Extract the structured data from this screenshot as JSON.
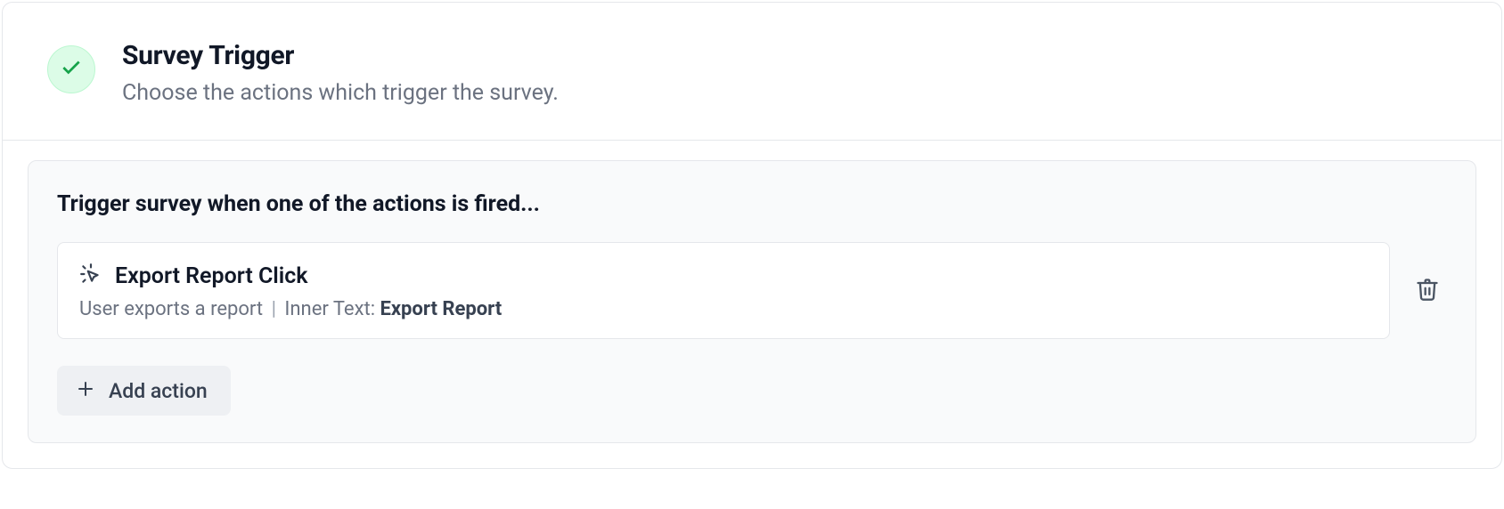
{
  "header": {
    "title": "Survey Trigger",
    "subtitle": "Choose the actions which trigger the survey."
  },
  "panel": {
    "heading": "Trigger survey when one of the actions is fired...",
    "action": {
      "name": "Export Report Click",
      "description": "User exports a report",
      "inner_text_label": "Inner Text: ",
      "inner_text_value": "Export Report"
    },
    "add_button_label": "Add action"
  }
}
